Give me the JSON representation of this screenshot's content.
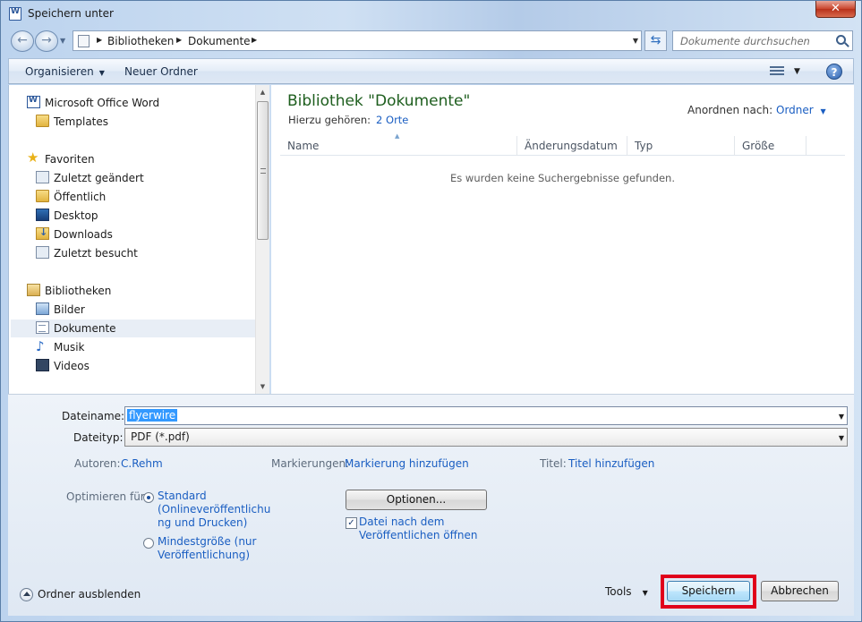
{
  "window": {
    "title": "Speichern unter",
    "close_label": "✕"
  },
  "address": {
    "crumbs": [
      "Bibliotheken",
      "Dokumente"
    ],
    "search_placeholder": "Dokumente durchsuchen"
  },
  "toolbar": {
    "organize": "Organisieren",
    "new_folder": "Neuer Ordner",
    "help": "?"
  },
  "nav": {
    "items": [
      {
        "label": "Microsoft Office Word",
        "icon": "word-icon"
      },
      {
        "label": "Templates",
        "icon": "folder-icon"
      },
      {
        "label": "Favoriten",
        "icon": "star-icon"
      },
      {
        "label": "Zuletzt geändert",
        "icon": "recent-changed-icon"
      },
      {
        "label": "Öffentlich",
        "icon": "folder-icon"
      },
      {
        "label": "Desktop",
        "icon": "desktop-icon"
      },
      {
        "label": "Downloads",
        "icon": "downloads-icon"
      },
      {
        "label": "Zuletzt besucht",
        "icon": "recent-places-icon"
      },
      {
        "label": "Bibliotheken",
        "icon": "library-icon"
      },
      {
        "label": "Bilder",
        "icon": "pictures-icon"
      },
      {
        "label": "Dokumente",
        "icon": "documents-icon"
      },
      {
        "label": "Musik",
        "icon": "music-icon"
      },
      {
        "label": "Videos",
        "icon": "videos-icon"
      }
    ]
  },
  "library": {
    "title": "Bibliothek \"Dokumente\"",
    "includes_label": "Hierzu gehören:",
    "includes_link": "2 Orte",
    "arrange_label": "Anordnen nach:",
    "arrange_value": "Ordner"
  },
  "columns": {
    "name": "Name",
    "date": "Änderungsdatum",
    "type": "Typ",
    "size": "Größe"
  },
  "empty_message": "Es wurden keine Suchergebnisse gefunden.",
  "form": {
    "filename_label": "Dateiname:",
    "filename_value": "flyerwire",
    "filetype_label": "Dateityp:",
    "filetype_value": "PDF (*.pdf)",
    "authors_label": "Autoren:",
    "authors_value": "C.Rehm",
    "tags_label": "Markierungen:",
    "tags_value": "Markierung hinzufügen",
    "title_label": "Titel:",
    "title_value": "Titel hinzufügen",
    "optimize_label": "Optimieren für:",
    "option_standard_l1": "Standard",
    "option_standard_l2": "(Onlineveröffentlichu",
    "option_standard_l3": "ng und Drucken)",
    "option_min_l1": "Mindestgröße (nur",
    "option_min_l2": "Veröffentlichung)",
    "options_button": "Optionen...",
    "open_after_l1": "Datei nach dem",
    "open_after_l2": "Veröffentlichen öffnen",
    "hide_folders": "Ordner ausblenden",
    "tools": "Tools",
    "save": "Speichern",
    "cancel": "Abbrechen"
  },
  "colors": {
    "highlight": "#e0001b",
    "link": "#1a5ec2",
    "library_title": "#1e5e1e"
  }
}
